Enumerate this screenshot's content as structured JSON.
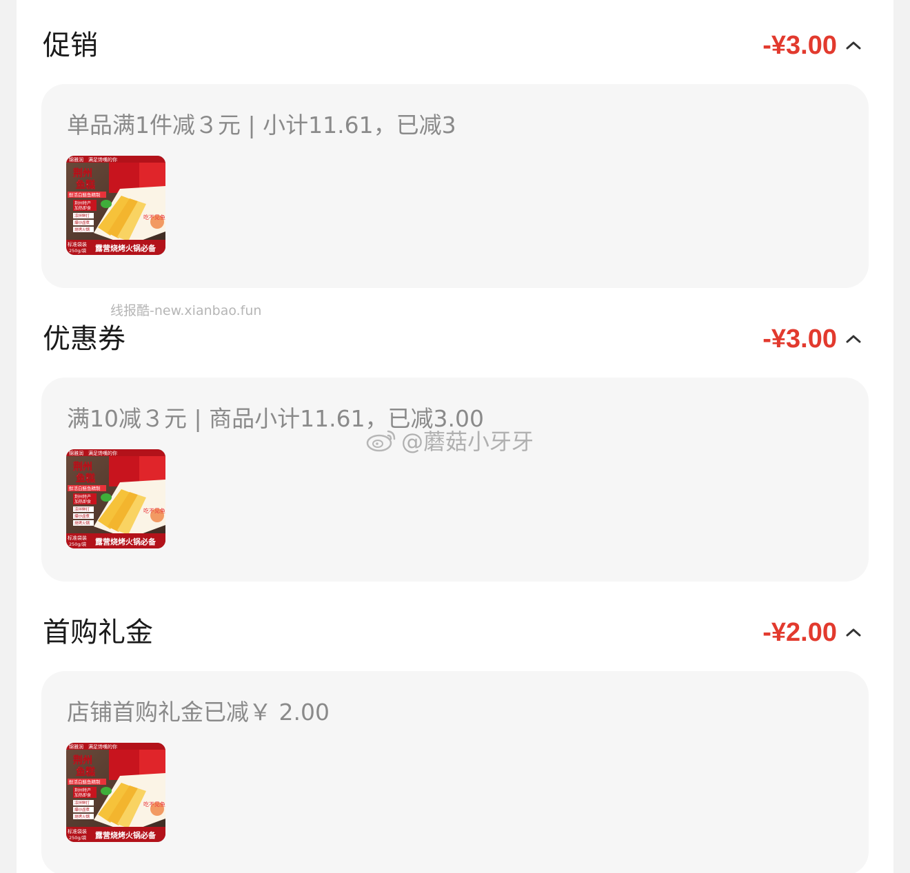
{
  "sections": [
    {
      "title": "促销",
      "amount": "-¥3.00",
      "description": "单品满1件减３元 | 小计11.61，已减3"
    },
    {
      "title": "优惠券",
      "amount": "-¥3.00",
      "description": "满10减３元 | 商品小计11.61，已减3.00"
    },
    {
      "title": "首购礼金",
      "amount": "-¥2.00",
      "description": "店铺首购礼金已减￥ 2.00"
    }
  ],
  "product_thumbnail": {
    "brand": "锦雅润",
    "slogan": "满足馋嘴的你",
    "name_line1": "荆州",
    "name_line2": "鱼糕",
    "tagline": "鲜活白鲢鱼精制",
    "feature1": "荆州特产",
    "feature2": "加热即食",
    "feature3": "凉拌鲜打",
    "feature4": "爆炒卤煮",
    "feature5": "烧烤火锅",
    "pack_label": "标准袋装",
    "weight": "250g/袋",
    "banner": "露营烧烤火锅必备",
    "badge": "吃不见鱼"
  },
  "watermarks": {
    "site": "线报酷-new.xianbao.fun",
    "weibo": "@蘑菇小牙牙"
  },
  "colors": {
    "accent_red": "#e23a2e",
    "card_bg": "#f6f6f6",
    "page_bg": "#ffffff"
  }
}
